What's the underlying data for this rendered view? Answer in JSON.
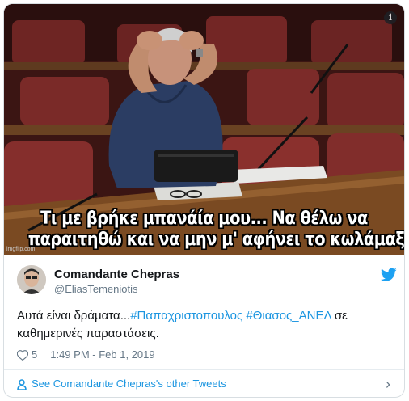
{
  "image": {
    "caption_line1": "Τι με βρήκε μπανάία μου... Να θέλω να",
    "caption_line2": "παραιτηθώ και να μην μ' αφήνει το κωλάμαξο...",
    "watermark": "imgflip.com",
    "info_icon": "info-icon"
  },
  "tweet": {
    "author_name": "Comandante Chepras",
    "handle": "@EliasTemeniotis",
    "text_prefix": "Αυτά είναι δράματα...",
    "hashtag1": "#Παπαχριστοπουλος",
    "hashtag2": "#Θιασος_ΑΝΕΛ",
    "text_middle": " σε",
    "text_line2": "καθημερινές παραστάσεις.",
    "likes": "5",
    "timestamp": "1:49 PM - Feb 1, 2019",
    "footer_link": "See Comandante Chepras's other Tweets",
    "brand_color": "#1b95e0",
    "icons": [
      "twitter-bird-icon",
      "heart-icon",
      "person-icon",
      "chevron-right-icon"
    ]
  }
}
